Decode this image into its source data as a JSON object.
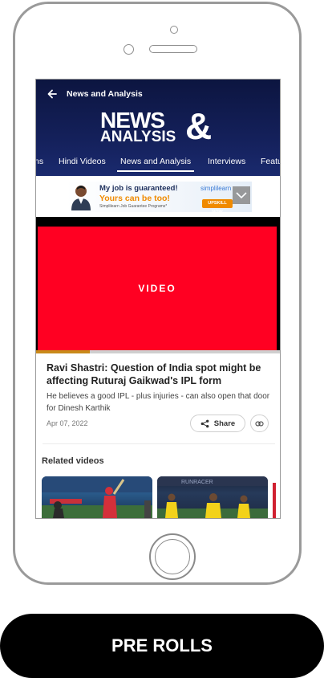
{
  "header": {
    "title": "News and Analysis",
    "logo_line1": "NEWS",
    "logo_line2": "ANALYSIS",
    "logo_amp": "&"
  },
  "tabs": [
    {
      "label": "ns"
    },
    {
      "label": "Hindi Videos"
    },
    {
      "label": "News and Analysis",
      "active": true
    },
    {
      "label": "Interviews"
    },
    {
      "label": "Featu"
    }
  ],
  "ad": {
    "line1": "My job is guaranteed!",
    "line2": "Yours can be too!",
    "line3": "Simplilearn Job Guarantee Programs*",
    "brand": "simplilearn",
    "cta": "UPSKILL NOW"
  },
  "video": {
    "label": "VIDEO",
    "progress_percent": 22
  },
  "article": {
    "title": "Ravi Shastri: Question of India spot might be affecting Ruturaj Gaikwad's IPL form",
    "description": "He believes a good IPL - plus injuries - can also open that door for Dinesh Karthik",
    "date": "Apr 07, 2022",
    "share_label": "Share"
  },
  "related": {
    "title": "Related videos",
    "thumb2_caption": "RUNRACER"
  },
  "footer": {
    "label": "PRE ROLLS"
  },
  "colors": {
    "header_bg": "#0c1540",
    "video_red": "#ff0022",
    "ad_orange": "#f08a00",
    "pill_bg": "#000000"
  },
  "icons": [
    "back-arrow-icon",
    "share-icon",
    "link-icon",
    "close-chevron-icon"
  ]
}
